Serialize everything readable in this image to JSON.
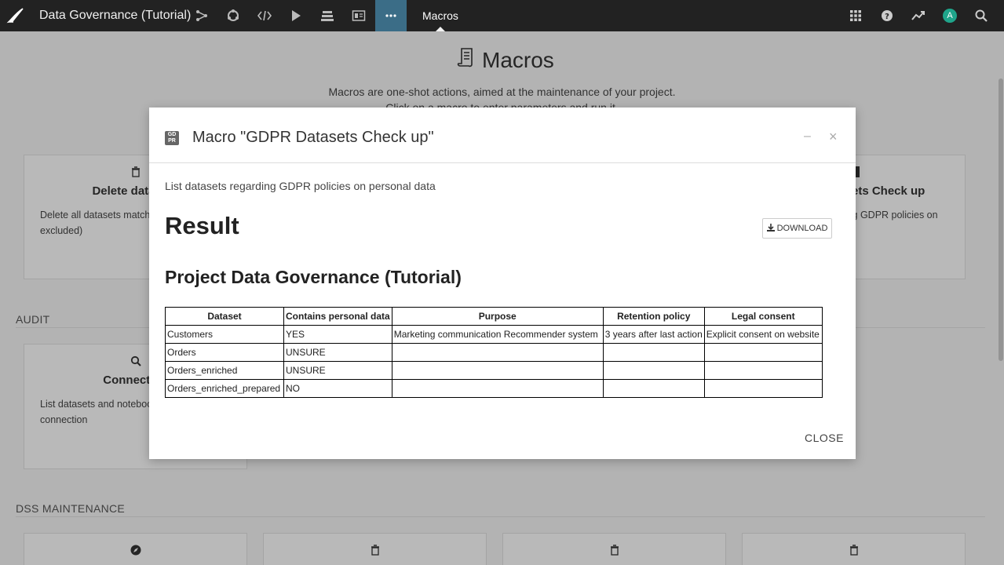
{
  "topbar": {
    "project_title": "Data Governance (Tutorial)",
    "current_page": "Macros",
    "avatar_initial": "A",
    "accent": "#3b6d87"
  },
  "page": {
    "title": "Macros",
    "subtitle1": "Macros are one-shot actions, aimed at the maintenance of your project.",
    "subtitle2": "Click on a macro to enter parameters and run it.",
    "sections": {
      "audit": "AUDIT",
      "dss_maintenance": "DSS MAINTENANCE"
    },
    "cards": {
      "delete_datasets": {
        "title": "Delete datasets",
        "desc": "Delete all datasets matching (included or excluded)"
      },
      "gdpr_check": {
        "title": "GDPR Datasets Check up",
        "desc": "List datasets regarding GDPR policies on personal data"
      },
      "connection": {
        "title": "Connection",
        "desc": "List datasets and notebooks using a connection"
      }
    }
  },
  "modal": {
    "title": "Macro \"GDPR Datasets Check up\"",
    "icon_text": "GD PR",
    "description": "List datasets regarding GDPR policies on personal data",
    "result_heading": "Result",
    "download_label": "DOWNLOAD",
    "project_heading": "Project Data Governance (Tutorial)",
    "close_label": "CLOSE",
    "table": {
      "headers": [
        "Dataset",
        "Contains personal data",
        "Purpose",
        "Retention policy",
        "Legal consent"
      ],
      "rows": [
        [
          "Customers",
          "YES",
          "Marketing communication Recommender system",
          "3 years after last action",
          "Explicit consent on website"
        ],
        [
          "Orders",
          "UNSURE",
          "",
          "",
          ""
        ],
        [
          "Orders_enriched",
          "UNSURE",
          "",
          "",
          ""
        ],
        [
          "Orders_enriched_prepared",
          "NO",
          "",
          "",
          ""
        ]
      ]
    }
  }
}
